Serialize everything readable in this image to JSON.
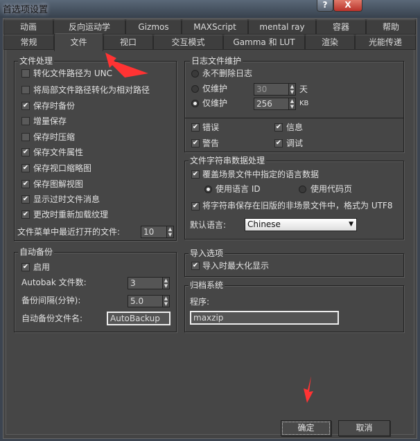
{
  "window": {
    "title": "首选项设置",
    "help_label": "?",
    "close_label": "X"
  },
  "tabs_row1": [
    "动画",
    "反向运动学",
    "Gizmos",
    "MAXScript",
    "mental ray",
    "容器",
    "帮助"
  ],
  "tabs_row2": [
    "常规",
    "文件",
    "视口",
    "交互模式",
    "Gamma 和 LUT",
    "渲染",
    "光能传递"
  ],
  "selected_tab": "文件",
  "file_handling": {
    "title": "文件处理",
    "items": [
      {
        "label": "转化文件路径为 UNC",
        "checked": false
      },
      {
        "label": "将局部文件路径转化为相对路径",
        "checked": false
      },
      {
        "label": "保存时备份",
        "checked": true
      },
      {
        "label": "增量保存",
        "checked": false
      },
      {
        "label": "保存时压缩",
        "checked": false
      },
      {
        "label": "保存文件属性",
        "checked": true
      },
      {
        "label": "保存视口缩略图",
        "checked": true
      },
      {
        "label": "保存图解视图",
        "checked": true
      },
      {
        "label": "显示过时文件消息",
        "checked": true
      },
      {
        "label": "更改时重新加载纹理",
        "checked": true
      }
    ],
    "recent_label": "文件菜单中最近打开的文件:",
    "recent_value": "10"
  },
  "auto_backup": {
    "title": "自动备份",
    "enable_label": "启用",
    "enabled": true,
    "count_label": "Autobak 文件数:",
    "count_value": "3",
    "interval_label": "备份间隔(分钟):",
    "interval_value": "5.0",
    "name_label": "自动备份文件名:",
    "name_value": "AutoBackup"
  },
  "log": {
    "title": "日志文件维护",
    "never_label": "永不删除日志",
    "days_label": "仅维护",
    "days_value": "30",
    "days_unit": "天",
    "kb_label": "仅维护",
    "kb_value": "256",
    "kb_unit": "KB",
    "selected": "kb",
    "error_label": "错误",
    "warning_label": "警告",
    "info_label": "信息",
    "debug_label": "调试"
  },
  "strings": {
    "title": "文件字符串数据处理",
    "override_label": "覆盖场景文件中指定的语言数据",
    "use_lang_id": "使用语言 ID",
    "use_codepage": "使用代码页",
    "save_utf8_label": "将字符串保存在旧版的非场景文件中，格式为 UTF8",
    "default_lang_label": "默认语言:",
    "default_lang_value": "Chinese"
  },
  "import": {
    "title": "导入选项",
    "maximize_label": "导入时最大化显示"
  },
  "archive": {
    "title": "归档系统",
    "program_label": "程序:",
    "program_value": "maxzip"
  },
  "buttons": {
    "ok": "确定",
    "cancel": "取消"
  },
  "colors": {
    "annotation_arrow": "#ff3333",
    "background": "#464646"
  }
}
